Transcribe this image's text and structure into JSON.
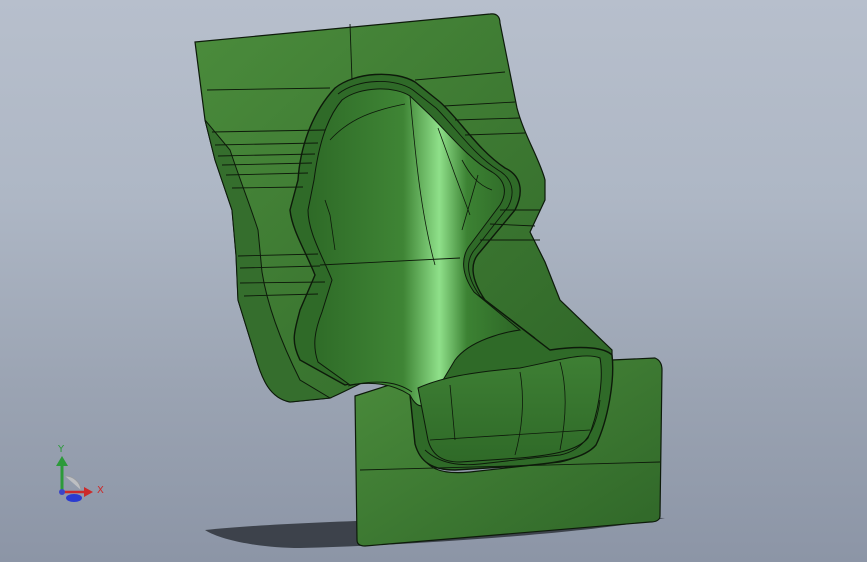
{
  "viewport": {
    "background_top": "#b7bfcc",
    "background_bottom": "#8c95a6"
  },
  "model": {
    "description_icon": "seat-mold-3d-model",
    "body_color": "#3f7a32",
    "edge_color": "#0d1a0a",
    "highlight_color": "#7fd27a"
  },
  "triad": {
    "x_label": "X",
    "y_label": "Y",
    "x_color": "#cc2a2a",
    "y_color": "#2c9a3a",
    "z_color": "#2a3bd0"
  }
}
